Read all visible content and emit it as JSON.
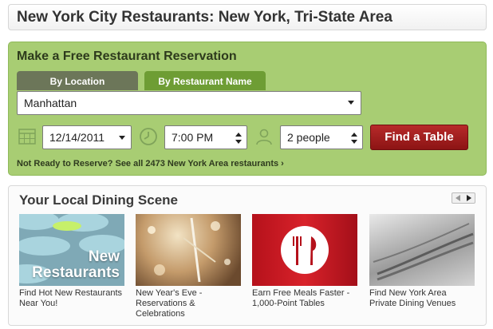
{
  "header": {
    "title": "New York City Restaurants: New York, Tri-State Area"
  },
  "reservation": {
    "title": "Make a Free Restaurant Reservation",
    "tabs": [
      {
        "label": "By Location",
        "active": true
      },
      {
        "label": "By Restaurant Name",
        "active": false
      }
    ],
    "location": {
      "value": "Manhattan"
    },
    "date": {
      "value": "12/14/2011",
      "icon": "calendar-icon"
    },
    "time": {
      "value": "7:00 PM",
      "icon": "clock-icon"
    },
    "party": {
      "value": "2 people",
      "icon": "person-icon"
    },
    "find_button": "Find a Table",
    "not_ready_link": "Not Ready to Reserve? See all 2473 New York Area restaurants ›",
    "colors": {
      "panel": "#a8cd73",
      "button": "#a31e1e",
      "tab_active": "#6c7659",
      "tab_inactive": "#6e9d34"
    }
  },
  "dining": {
    "title": "Your Local Dining Scene",
    "pager": {
      "prev_icon": "triangle-left-icon",
      "next_icon": "triangle-right-icon"
    },
    "tiles": [
      {
        "caption": "Find Hot New Restaurants Near You!",
        "image_text_1": "New",
        "image_text_2": "Restaurants"
      },
      {
        "caption": "New Year's Eve - Reservations & Celebrations"
      },
      {
        "caption": "Earn Free Meals Faster - 1,000-Point Tables"
      },
      {
        "caption": "Find New York Area Private Dining Venues"
      }
    ]
  }
}
